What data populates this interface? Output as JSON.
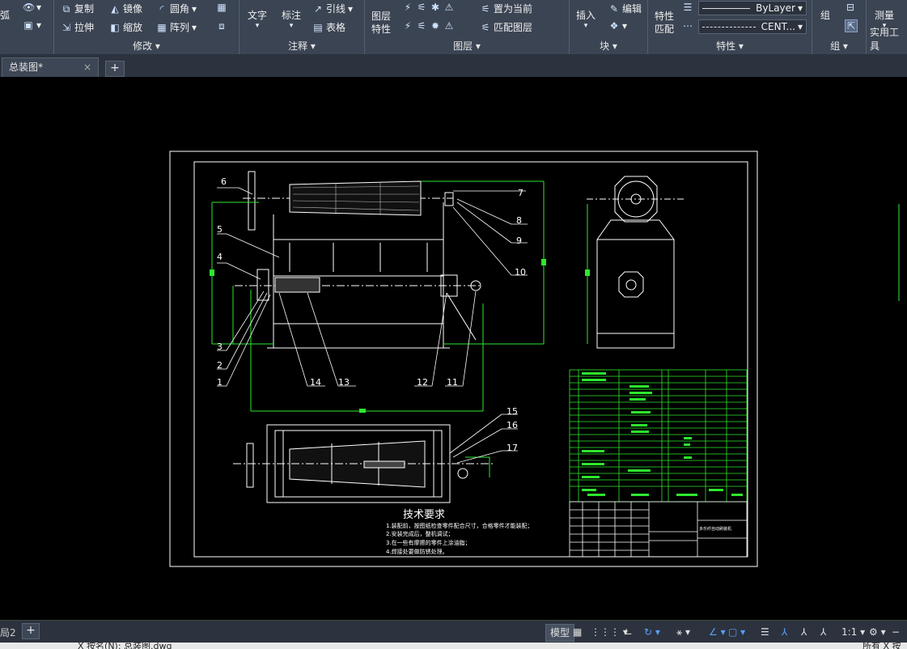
{
  "ribbon": {
    "left_cut": {
      "arc_label": "弧"
    },
    "modify": {
      "title": "修改",
      "copy": "复制",
      "mirror": "镜像",
      "fillet": "圆角",
      "stretch": "拉伸",
      "scale": "缩放",
      "array": "阵列"
    },
    "annotation": {
      "title": "注释",
      "text": "文字",
      "dimension": "标注",
      "leader": "引线",
      "table": "表格"
    },
    "layers": {
      "title": "图层",
      "layer_props_l1": "图层",
      "layer_props_l2": "特性",
      "set_current": "置为当前",
      "match_layer": "匹配图层"
    },
    "block": {
      "title": "块",
      "insert": "插入",
      "edit": "编辑"
    },
    "properties": {
      "title": "特性",
      "match_l1": "特性",
      "match_l2": "匹配",
      "bylayer": "ByLayer",
      "linetype": "CENT..."
    },
    "groups": {
      "title": "组",
      "group": "组"
    },
    "utilities": {
      "title": "实用工具",
      "measure": "测量"
    }
  },
  "tabs": {
    "doc_tab": "总装图*",
    "close": "×",
    "plus": "+"
  },
  "drawing": {
    "labels": [
      "1",
      "2",
      "3",
      "4",
      "5",
      "6",
      "7",
      "8",
      "9",
      "10",
      "11",
      "12",
      "13",
      "14",
      "15",
      "16",
      "17"
    ],
    "tech_title": "技术要求",
    "tech_notes": [
      "1.装配前，按图纸检查零件配合尺寸，合格零件才能装配；",
      "2.安装完成后，整机调试；",
      "3.在一些有摩擦的零件上涂油脂；",
      "4.焊接处要做防锈处理。"
    ],
    "title_block_text": "多乐纤自动刷装机"
  },
  "status": {
    "layout_tab": "局2",
    "plus": "+",
    "model": "模型",
    "scale": "1:1"
  },
  "cmdline": {
    "text": "X 按名(N): 总装图.dwg",
    "right_text": "所有 X 按"
  }
}
